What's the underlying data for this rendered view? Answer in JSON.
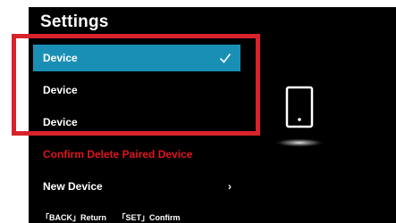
{
  "screen": {
    "title": "Settings",
    "menu": [
      {
        "label": "Device",
        "selected": true,
        "checked": true
      },
      {
        "label": "Device",
        "selected": false
      },
      {
        "label": "Device",
        "selected": false
      },
      {
        "label": "Confirm Delete Paired Device",
        "danger": true
      },
      {
        "label": "New Device",
        "has_submenu": true
      }
    ],
    "submenu_glyph": "›",
    "footer": {
      "back_hint": "「BACK」Return",
      "set_hint": "「SET」Confirm"
    },
    "illustration": "smartphone-icon"
  },
  "annotation": {
    "highlight_color": "#d8232a"
  },
  "colors": {
    "selected_bg": "#1a8fb5",
    "danger_text": "#e0141e",
    "background": "#000000"
  }
}
